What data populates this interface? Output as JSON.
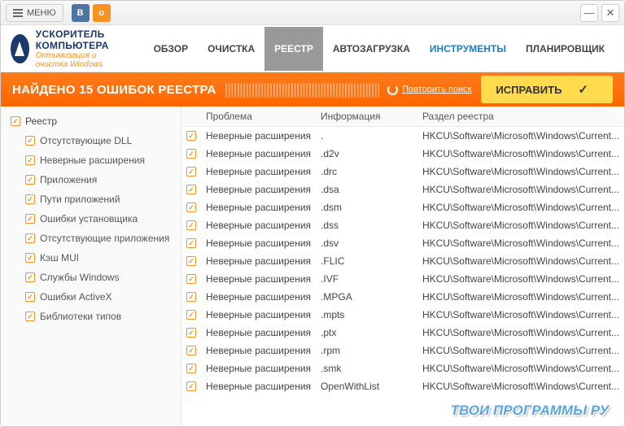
{
  "titlebar": {
    "menu": "МЕНЮ"
  },
  "logo": {
    "title": "УСКОРИТЕЛЬ КОМПЬЮТЕРА",
    "subtitle": "Оптимизация и очистка Windows"
  },
  "nav": {
    "items": [
      {
        "label": "ОБЗОР"
      },
      {
        "label": "ОЧИСТКА"
      },
      {
        "label": "РЕЕСТР"
      },
      {
        "label": "АВТОЗАГРУЗКА"
      },
      {
        "label": "ИНСТРУМЕНТЫ"
      },
      {
        "label": "ПЛАНИРОВЩИК"
      }
    ]
  },
  "status": {
    "text": "НАЙДЕНО 15 ОШИБОК РЕЕСТРА",
    "repeat": "Повторить поиск",
    "fix": "ИСПРАВИТЬ"
  },
  "sidebar": {
    "header": "Реестр",
    "items": [
      {
        "label": "Отсутствующие DLL"
      },
      {
        "label": "Неверные расширения"
      },
      {
        "label": "Приложения"
      },
      {
        "label": "Пути приложений"
      },
      {
        "label": "Ошибки установщика"
      },
      {
        "label": "Отсутствующие приложения"
      },
      {
        "label": "Кэш MUI"
      },
      {
        "label": "Службы Windows"
      },
      {
        "label": "Ошибки ActiveX"
      },
      {
        "label": "Библиотеки типов"
      }
    ]
  },
  "table": {
    "headers": {
      "problem": "Проблема",
      "info": "Информация",
      "section": "Раздел реестра"
    },
    "rows": [
      {
        "problem": "Неверные расширения",
        "info": ".",
        "section": "HKCU\\Software\\Microsoft\\Windows\\Current..."
      },
      {
        "problem": "Неверные расширения",
        "info": ".d2v",
        "section": "HKCU\\Software\\Microsoft\\Windows\\Current..."
      },
      {
        "problem": "Неверные расширения",
        "info": ".drc",
        "section": "HKCU\\Software\\Microsoft\\Windows\\Current..."
      },
      {
        "problem": "Неверные расширения",
        "info": ".dsa",
        "section": "HKCU\\Software\\Microsoft\\Windows\\Current..."
      },
      {
        "problem": "Неверные расширения",
        "info": ".dsm",
        "section": "HKCU\\Software\\Microsoft\\Windows\\Current..."
      },
      {
        "problem": "Неверные расширения",
        "info": ".dss",
        "section": "HKCU\\Software\\Microsoft\\Windows\\Current..."
      },
      {
        "problem": "Неверные расширения",
        "info": ".dsv",
        "section": "HKCU\\Software\\Microsoft\\Windows\\Current..."
      },
      {
        "problem": "Неверные расширения",
        "info": ".FLIC",
        "section": "HKCU\\Software\\Microsoft\\Windows\\Current..."
      },
      {
        "problem": "Неверные расширения",
        "info": ".IVF",
        "section": "HKCU\\Software\\Microsoft\\Windows\\Current..."
      },
      {
        "problem": "Неверные расширения",
        "info": ".MPGA",
        "section": "HKCU\\Software\\Microsoft\\Windows\\Current..."
      },
      {
        "problem": "Неверные расширения",
        "info": ".mpts",
        "section": "HKCU\\Software\\Microsoft\\Windows\\Current..."
      },
      {
        "problem": "Неверные расширения",
        "info": ".ptx",
        "section": "HKCU\\Software\\Microsoft\\Windows\\Current..."
      },
      {
        "problem": "Неверные расширения",
        "info": ".rpm",
        "section": "HKCU\\Software\\Microsoft\\Windows\\Current..."
      },
      {
        "problem": "Неверные расширения",
        "info": ".smk",
        "section": "HKCU\\Software\\Microsoft\\Windows\\Current..."
      },
      {
        "problem": "Неверные расширения",
        "info": "OpenWithList",
        "section": "HKCU\\Software\\Microsoft\\Windows\\Current..."
      }
    ]
  },
  "watermark": "ТВОИ ПРОГРАММЫ РУ"
}
